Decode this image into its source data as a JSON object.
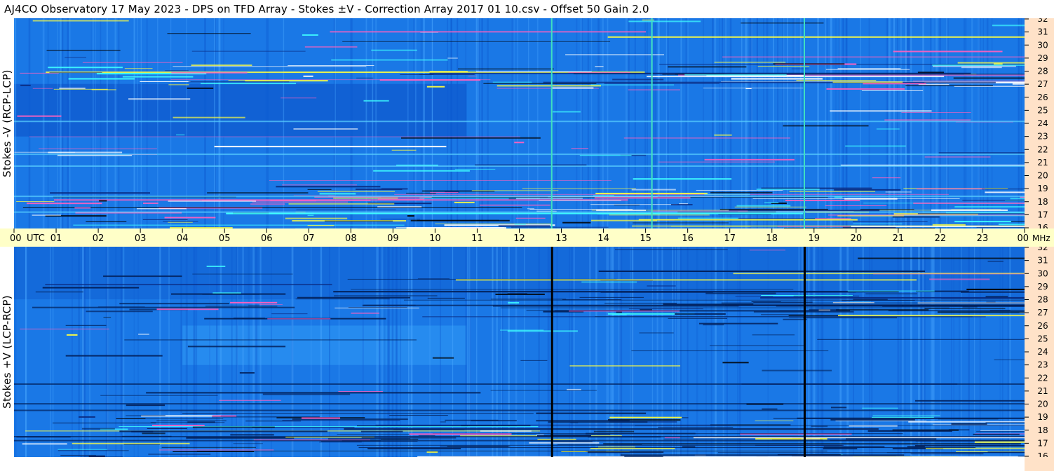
{
  "header": {
    "title": "AJ4CO Observatory  17 May 2023  -  DPS on TFD Array  -  Stokes ±V  -  Correction Array 2017 01 10.csv  -  Offset 50  Gain 2.0"
  },
  "colors": {
    "background": "#1a78e6",
    "background_dark": "#0b4fc4",
    "time_bar": "#ffffc8",
    "freq_axis": "#ffe2c8",
    "interference_yellow": "#ffff40",
    "interference_cyan": "#40ffff",
    "interference_black": "#000000",
    "interference_magenta": "#ff60c0"
  },
  "chart_data": [
    {
      "type": "heatmap",
      "name": "stokes-minus-v",
      "ylabel": "Stokes -V  (RCP-LCP)",
      "x_range_utc_hours": [
        0,
        24
      ],
      "freq_ticks": [
        "32",
        "31",
        "30",
        "29",
        "28",
        "27",
        "26",
        "25",
        "24",
        "23",
        "22",
        "21",
        "20",
        "19",
        "18",
        "17",
        "16"
      ],
      "ylim_mhz": [
        16,
        32
      ],
      "vertical_lines_utc": [
        12.77,
        15.15,
        18.77
      ],
      "vertical_line_color": "#40e0c0",
      "darker_region_utc": [
        0,
        10.75
      ],
      "darker_region_mhz": [
        23,
        27
      ]
    },
    {
      "type": "heatmap",
      "name": "stokes-plus-v",
      "ylabel": "Stokes +V  (LCP-RCP)",
      "x_range_utc_hours": [
        0,
        24
      ],
      "freq_ticks": [
        "32",
        "31",
        "30",
        "29",
        "28",
        "27",
        "26",
        "25",
        "24",
        "23",
        "22",
        "21",
        "20",
        "19",
        "18",
        "17",
        "16"
      ],
      "ylim_mhz": [
        16,
        32
      ],
      "vertical_lines_utc": [
        12.77,
        18.77
      ],
      "vertical_line_color": "#000000",
      "lighter_region_utc": [
        4,
        10.75
      ],
      "lighter_region_mhz": [
        23,
        26
      ]
    }
  ],
  "time_axis": {
    "ticks": [
      "00",
      "01",
      "02",
      "03",
      "04",
      "05",
      "06",
      "07",
      "08",
      "09",
      "10",
      "11",
      "12",
      "13",
      "14",
      "15",
      "16",
      "17",
      "18",
      "19",
      "20",
      "21",
      "22",
      "23",
      "00"
    ],
    "utc_label": "UTC",
    "mhz_label": "MHz"
  }
}
